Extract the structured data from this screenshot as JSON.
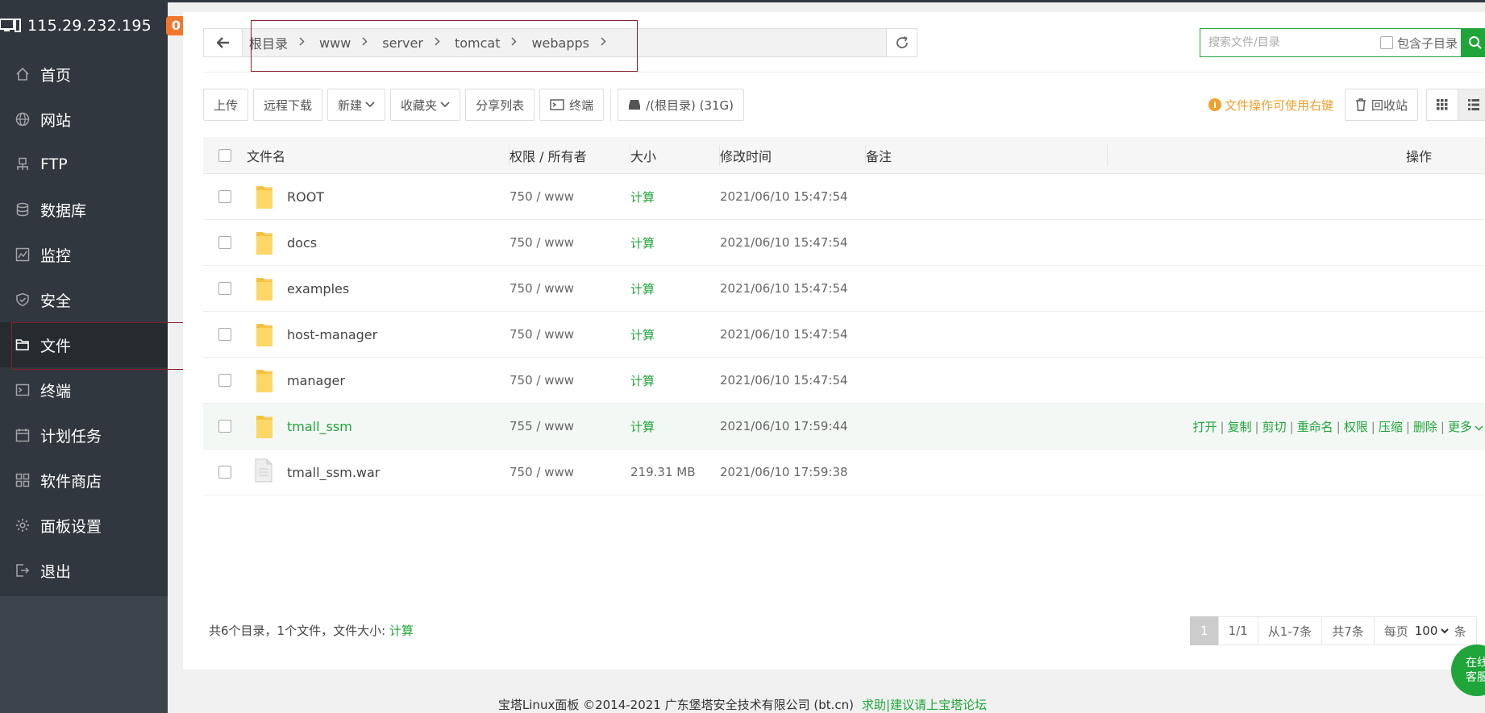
{
  "server": {
    "ip": "115.29.232.195",
    "badge": "0"
  },
  "menu": [
    {
      "label": "首页",
      "icon": "home-icon"
    },
    {
      "label": "网站",
      "icon": "globe-icon"
    },
    {
      "label": "FTP",
      "icon": "ftp-icon"
    },
    {
      "label": "数据库",
      "icon": "database-icon"
    },
    {
      "label": "监控",
      "icon": "monitor-icon"
    },
    {
      "label": "安全",
      "icon": "shield-icon"
    },
    {
      "label": "文件",
      "icon": "folder-icon",
      "active": true
    },
    {
      "label": "终端",
      "icon": "terminal-icon"
    },
    {
      "label": "计划任务",
      "icon": "calendar-icon"
    },
    {
      "label": "软件商店",
      "icon": "apps-icon"
    },
    {
      "label": "面板设置",
      "icon": "gear-icon"
    },
    {
      "label": "退出",
      "icon": "logout-icon"
    }
  ],
  "path": {
    "crumbs": [
      "根目录",
      "www",
      "server",
      "tomcat",
      "webapps"
    ]
  },
  "search": {
    "placeholder": "搜索文件/目录",
    "subdir_label": "包含子目录"
  },
  "toolbar": {
    "upload": "上传",
    "remote_download": "远程下载",
    "new": "新建",
    "favorites": "收藏夹",
    "share_list": "分享列表",
    "terminal": "终端",
    "disk": "/(根目录) (31G)",
    "tip": "文件操作可使用右键",
    "recycle": "回收站"
  },
  "table": {
    "headers": {
      "name": "文件名",
      "perm": "权限 / 所有者",
      "size": "大小",
      "time": "修改时间",
      "note": "备注",
      "op": "操作"
    },
    "rows": [
      {
        "name": "ROOT",
        "type": "folder",
        "perm": "750 / www",
        "size": "计算",
        "time": "2021/06/10 15:47:54"
      },
      {
        "name": "docs",
        "type": "folder",
        "perm": "750 / www",
        "size": "计算",
        "time": "2021/06/10 15:47:54"
      },
      {
        "name": "examples",
        "type": "folder",
        "perm": "750 / www",
        "size": "计算",
        "time": "2021/06/10 15:47:54"
      },
      {
        "name": "host-manager",
        "type": "folder",
        "perm": "750 / www",
        "size": "计算",
        "time": "2021/06/10 15:47:54"
      },
      {
        "name": "manager",
        "type": "folder",
        "perm": "750 / www",
        "size": "计算",
        "time": "2021/06/10 15:47:54"
      },
      {
        "name": "tmall_ssm",
        "type": "folder",
        "perm": "755 / www",
        "size": "计算",
        "time": "2021/06/10 17:59:44",
        "hover": true
      },
      {
        "name": "tmall_ssm.war",
        "type": "file",
        "perm": "750 / www",
        "size": "219.31 MB",
        "time": "2021/06/10 17:59:38"
      }
    ],
    "row_ops": [
      "打开",
      "复制",
      "剪切",
      "重命名",
      "权限",
      "压缩",
      "删除",
      "更多"
    ]
  },
  "summary": {
    "text": "共6个目录，1个文件，文件大小: ",
    "calc": "计算"
  },
  "pager": {
    "current": "1",
    "pages": "1/1",
    "range": "从1-7条",
    "total": "共7条",
    "per_page_label": "每页",
    "per_page": "100",
    "unit": "条"
  },
  "footer": {
    "copyright": "宝塔Linux面板 ©2014-2021 广东堡塔安全技术有限公司 (bt.cn)",
    "link": "求助|建议请上宝塔论坛"
  },
  "chat": {
    "line1": "在线",
    "line2": "客服"
  },
  "colors": {
    "accent": "#20a53a",
    "sidebar": "#30373e",
    "badge": "#f0762e",
    "tip": "#f0a030",
    "highlight_box": "#8b1d2c"
  }
}
